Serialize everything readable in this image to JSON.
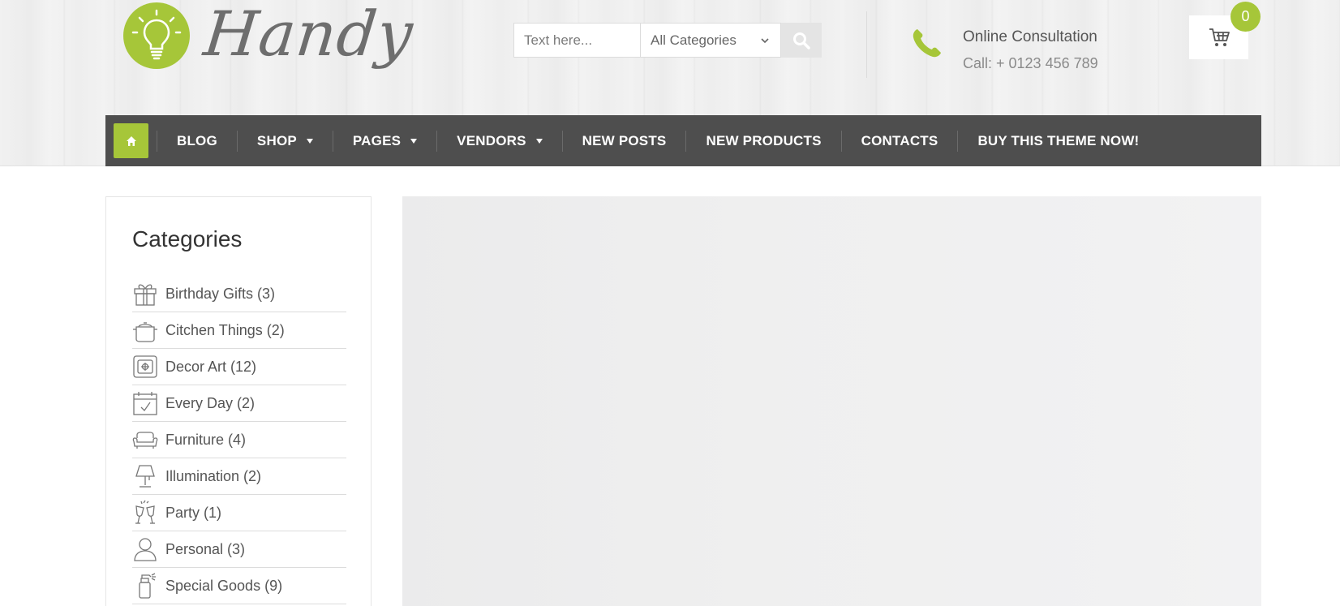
{
  "brand": {
    "name": "Handy",
    "accent": "#a6c639"
  },
  "search": {
    "placeholder": "Text here...",
    "category_selected": "All Categories",
    "button_icon": "search-icon"
  },
  "consultation": {
    "title": "Online Consultation",
    "phone": "Call: + 0123 456 789",
    "icon": "phone-icon"
  },
  "cart": {
    "count": "0",
    "icon": "cart-icon"
  },
  "nav": {
    "home_icon": "home-icon",
    "items": [
      {
        "label": "BLOG",
        "dropdown": false
      },
      {
        "label": "SHOP",
        "dropdown": true
      },
      {
        "label": "PAGES",
        "dropdown": true
      },
      {
        "label": "VENDORS",
        "dropdown": true
      },
      {
        "label": "NEW POSTS",
        "dropdown": false
      },
      {
        "label": "NEW PRODUCTS",
        "dropdown": false
      },
      {
        "label": "CONTACTS",
        "dropdown": false
      },
      {
        "label": "BUY THIS THEME NOW!",
        "dropdown": false
      }
    ]
  },
  "sidebar": {
    "title": "Categories",
    "categories": [
      {
        "label": "Birthday Gifts (3)",
        "icon": "gift-icon"
      },
      {
        "label": "Citchen Things (2)",
        "icon": "pot-icon"
      },
      {
        "label": "Decor Art (12)",
        "icon": "frame-icon"
      },
      {
        "label": "Every Day (2)",
        "icon": "calendar-icon"
      },
      {
        "label": "Furniture (4)",
        "icon": "sofa-icon"
      },
      {
        "label": "Illumination (2)",
        "icon": "lamp-icon"
      },
      {
        "label": "Party (1)",
        "icon": "glasses-icon"
      },
      {
        "label": "Personal (3)",
        "icon": "person-icon"
      },
      {
        "label": "Special Goods (9)",
        "icon": "spray-bottle-icon"
      }
    ]
  }
}
